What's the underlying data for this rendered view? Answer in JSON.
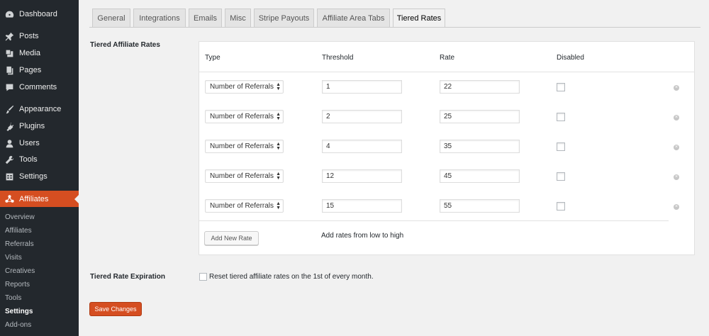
{
  "sidebar": {
    "menu": [
      {
        "label": "Dashboard",
        "icon": "dashboard-icon"
      },
      {
        "label": "Posts",
        "icon": "pin-icon"
      },
      {
        "label": "Media",
        "icon": "media-icon"
      },
      {
        "label": "Pages",
        "icon": "pages-icon"
      },
      {
        "label": "Comments",
        "icon": "comment-icon"
      },
      {
        "label": "Appearance",
        "icon": "brush-icon"
      },
      {
        "label": "Plugins",
        "icon": "plug-icon"
      },
      {
        "label": "Users",
        "icon": "user-icon"
      },
      {
        "label": "Tools",
        "icon": "wrench-icon"
      },
      {
        "label": "Settings",
        "icon": "settings-icon"
      },
      {
        "label": "Affiliates",
        "icon": "affiliates-icon"
      }
    ],
    "submenu": [
      "Overview",
      "Affiliates",
      "Referrals",
      "Visits",
      "Creatives",
      "Reports",
      "Tools",
      "Settings",
      "Add-ons"
    ],
    "current_submenu": "Settings"
  },
  "tabs": [
    "General",
    "Integrations",
    "Emails",
    "Misc",
    "Stripe Payouts",
    "Affiliate Area Tabs",
    "Tiered Rates"
  ],
  "active_tab": "Tiered Rates",
  "tiered_rates": {
    "section_label": "Tiered Affiliate Rates",
    "columns": [
      "Type",
      "Threshold",
      "Rate",
      "Disabled"
    ],
    "rows": [
      {
        "type": "Number of Referrals",
        "threshold": "1",
        "rate": "22",
        "disabled": false
      },
      {
        "type": "Number of Referrals",
        "threshold": "2",
        "rate": "25",
        "disabled": false
      },
      {
        "type": "Number of Referrals",
        "threshold": "4",
        "rate": "35",
        "disabled": false
      },
      {
        "type": "Number of Referrals",
        "threshold": "12",
        "rate": "45",
        "disabled": false
      },
      {
        "type": "Number of Referrals",
        "threshold": "15",
        "rate": "55",
        "disabled": false
      }
    ],
    "add_button": "Add New Rate",
    "add_hint": "Add rates from low to high"
  },
  "expiration": {
    "label": "Tiered Rate Expiration",
    "checkbox_label": "Reset tiered affiliate rates on the 1st of every month.",
    "checked": false
  },
  "save_button": "Save Changes",
  "colors": {
    "accent": "#d54e21",
    "sidebar_bg": "#23282d",
    "page_bg": "#f1f1f1"
  }
}
